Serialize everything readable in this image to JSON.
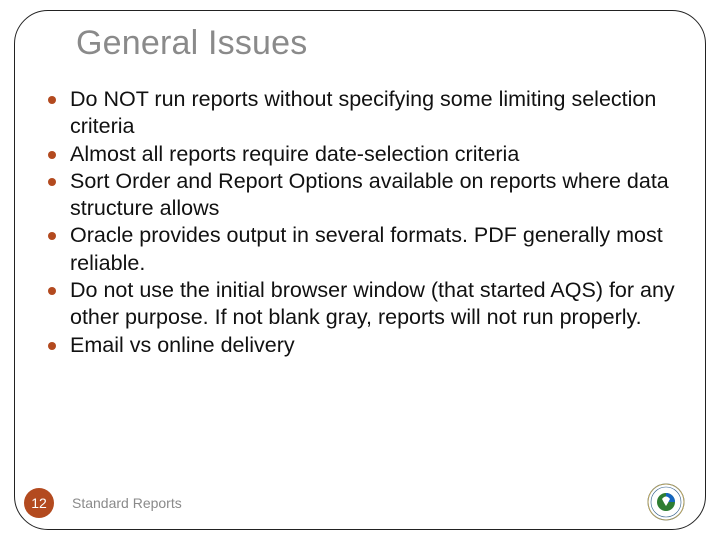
{
  "title": "General Issues",
  "bullets": [
    "Do NOT run reports without specifying some limiting selection criteria",
    "Almost all reports require date-selection criteria",
    "Sort Order and Report Options available on reports where data structure allows",
    "Oracle provides output in several formats. PDF generally most reliable.",
    "Do not use the initial browser window (that started AQS) for any other purpose.  If not blank gray, reports will not run properly.",
    "Email vs online delivery"
  ],
  "page_number": "12",
  "footer_text": "Standard Reports",
  "colors": {
    "accent": "#b34a1f",
    "title_gray": "#8a8a8a"
  }
}
